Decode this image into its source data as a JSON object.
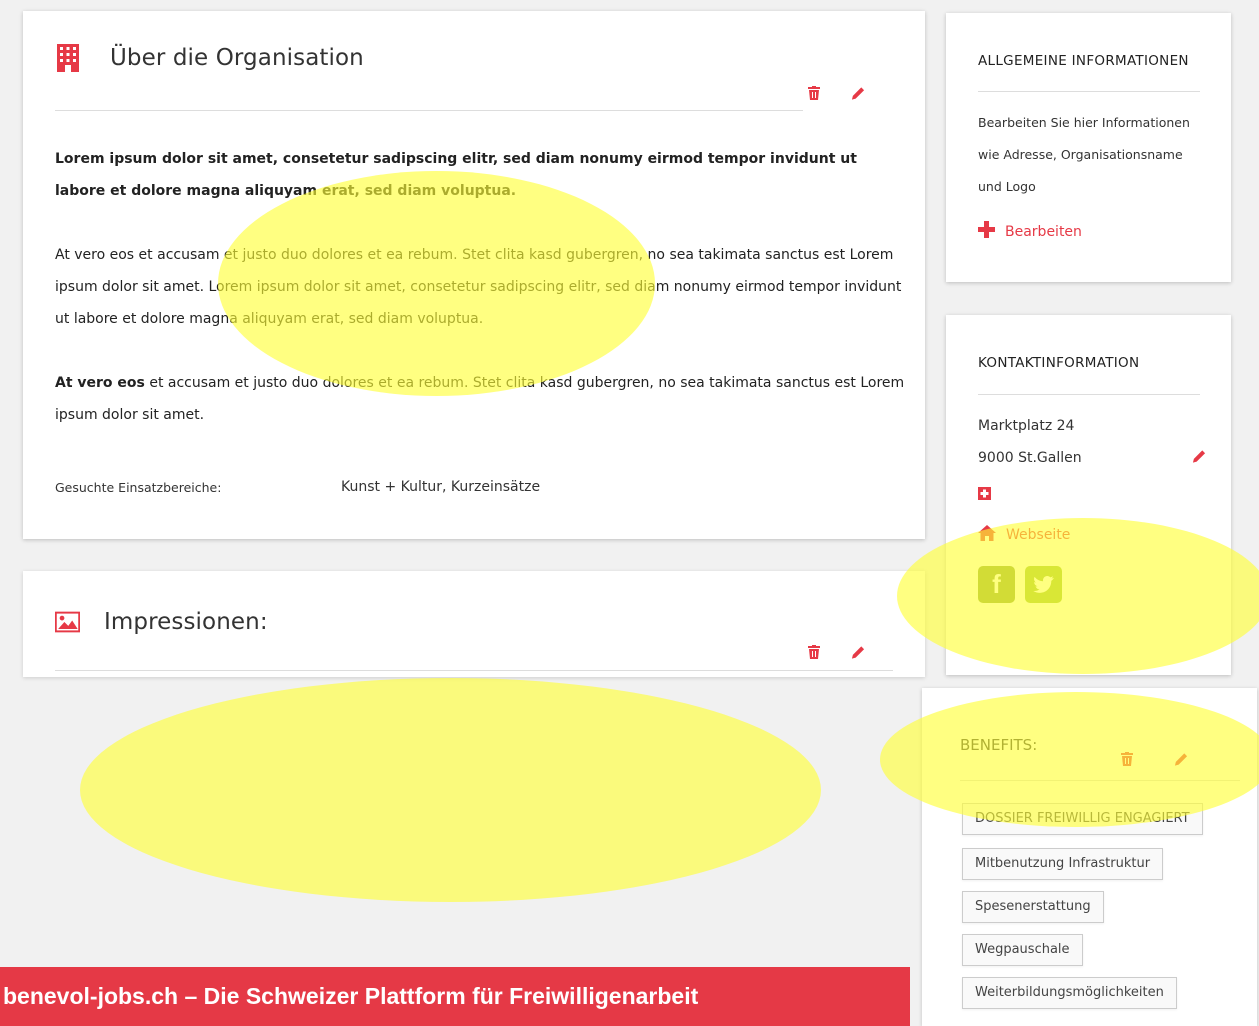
{
  "about": {
    "title": "Über die Organisation",
    "paragraph1": "Lorem ipsum dolor sit amet, consetetur sadipscing elitr, sed diam nonumy eirmod tempor invidunt ut labore et dolore magna aliquyam erat, sed diam voluptua.",
    "paragraph2": "At vero eos et accusam et justo duo dolores et ea rebum. Stet clita kasd gubergren, no sea takimata sanctus est Lorem ipsum dolor sit amet. Lorem ipsum dolor sit amet, consetetur sadipscing elitr, sed diam nonumy eirmod tempor invidunt ut labore et dolore magna aliquyam erat, sed diam voluptua.",
    "paragraph3_bold": "At vero eos",
    "paragraph3_rest": " et accusam et justo duo dolores et ea rebum. Stet clita kasd gubergren, no sea takimata sanctus est Lorem ipsum dolor sit amet.",
    "einsatz_label": "Gesuchte Einsatzbereiche:",
    "einsatz_value": "Kunst + Kultur, Kurzeinsätze"
  },
  "impressions": {
    "title": "Impressionen:"
  },
  "allgemein": {
    "heading": "ALLGEMEINE INFORMATIONEN",
    "line1": "Bearbeiten Sie hier Informationen",
    "line2": "wie Adresse, Organisationsname",
    "line3": "und Logo",
    "edit_label": "Bearbeiten"
  },
  "kontakt": {
    "heading": "KONTAKTINFORMATION",
    "street": "Marktplatz 24",
    "city": "9000 St.Gallen",
    "website_label": "Webseite"
  },
  "benefits": {
    "heading": "BENEFITS:",
    "tags": [
      "DOSSIER FREIWILLIG ENGAGIERT",
      "Mitbenutzung Infrastruktur",
      "Spesenerstattung",
      "Wegpauschale",
      "Weiterbildungsmöglichkeiten"
    ]
  },
  "banner": {
    "text": "benevol-jobs.ch – Die Schweizer Plattform für Freiwilligenarbeit"
  },
  "colors": {
    "accent_red": "#e63946",
    "highlight_yellow": "#ffff33",
    "facebook_green": "#8aa33a",
    "twitter_green": "#9cbf3a"
  },
  "icons": [
    "building-icon",
    "trash-icon",
    "pencil-icon",
    "image-icon",
    "plus-icon",
    "swiss-flag-icon",
    "home-icon",
    "facebook-icon",
    "twitter-icon"
  ]
}
